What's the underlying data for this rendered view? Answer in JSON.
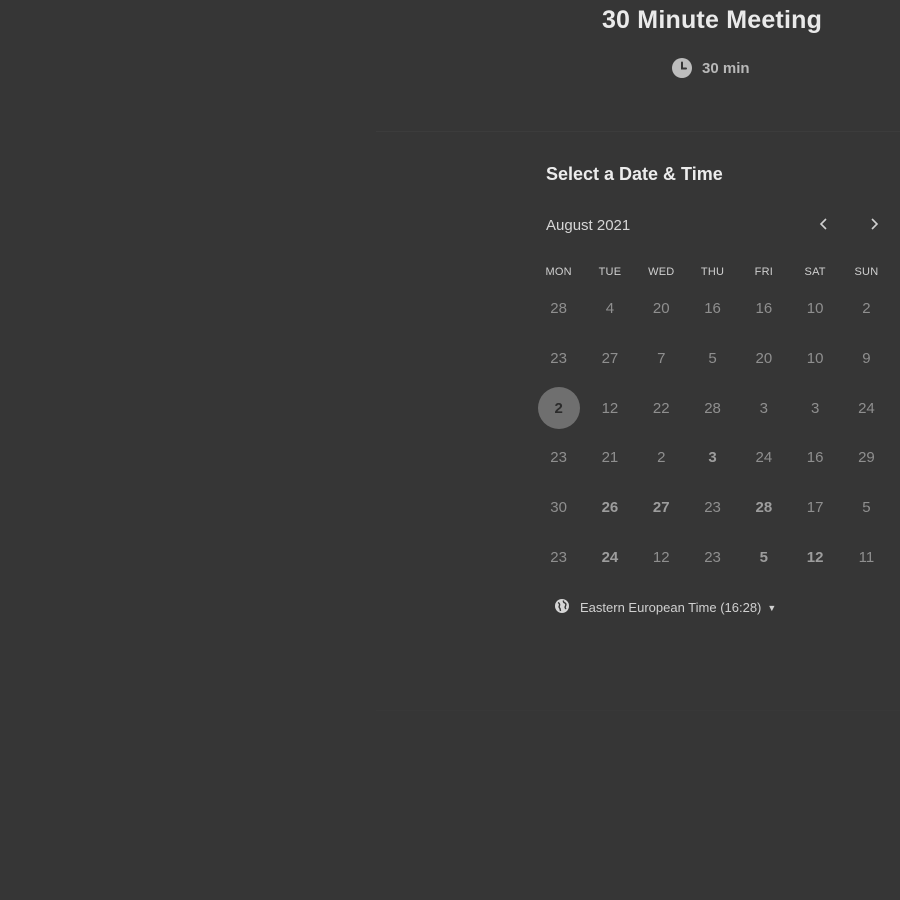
{
  "meeting": {
    "title": "30 Minute Meeting",
    "duration": "30 min",
    "duration_icon": "clock-icon"
  },
  "scheduler": {
    "title": "Select a Date & Time",
    "month": "August 2021",
    "prev_icon": "chevron-left-icon",
    "next_icon": "chevron-right-icon",
    "weekdays": [
      "MON",
      "TUE",
      "WED",
      "THU",
      "FRI",
      "SAT",
      "SUN"
    ],
    "weeks": [
      [
        "28",
        "4",
        "20",
        "16",
        "16",
        "10",
        "2"
      ],
      [
        "23",
        "27",
        "7",
        "5",
        "20",
        "10",
        "9"
      ],
      [
        "2",
        "12",
        "22",
        "28",
        "3",
        "3",
        "24"
      ],
      [
        "23",
        "21",
        "2",
        "3",
        "24",
        "16",
        "29"
      ],
      [
        "30",
        "26",
        "27",
        "23",
        "28",
        "17",
        "5"
      ],
      [
        "23",
        "24",
        "12",
        "23",
        "5",
        "12",
        "11"
      ]
    ],
    "available_days": [
      [
        3,
        3
      ],
      [
        4,
        1
      ],
      [
        4,
        2
      ],
      [
        4,
        4
      ],
      [
        5,
        1
      ],
      [
        5,
        4
      ],
      [
        5,
        5
      ]
    ],
    "selected_day": [
      2,
      0
    ],
    "timezone": "Eastern European Time (16:28)",
    "timezone_icon": "globe-icon"
  },
  "colors": {
    "background": "#363636",
    "selected_circle": "#6f6f6f"
  }
}
